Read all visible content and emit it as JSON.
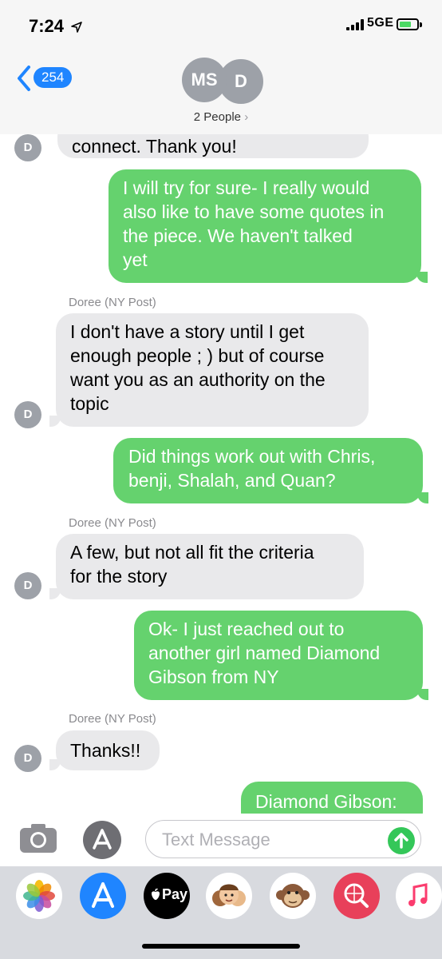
{
  "status": {
    "time": "7:24",
    "network": "5GE"
  },
  "header": {
    "back_count": "254",
    "avatar1": "MS",
    "avatar2": "D",
    "people_label": "2 People"
  },
  "messages": [
    {
      "text": "connect. Thank you!",
      "dir": "in"
    },
    {
      "lines": [
        "I will try for sure- I really would",
        "also like to have some quotes in",
        "the piece. We haven't talked",
        "yet"
      ],
      "dir": "out"
    },
    {
      "sender": "Doree (NY Post)"
    },
    {
      "lines": [
        "I don't have a story until I get",
        "enough people ; ) but of course",
        "want you as an authority on the",
        "topic"
      ],
      "dir": "in"
    },
    {
      "lines": [
        "Did things work out with Chris,",
        "benji, Shalah, and Quan?"
      ],
      "dir": "out"
    },
    {
      "sender": "Doree (NY Post)"
    },
    {
      "lines": [
        "A few, but not all fit the criteria",
        "for the story"
      ],
      "dir": "in"
    },
    {
      "lines": [
        "Ok- I just reached out to",
        "another girl named Diamond",
        "Gibson from NY"
      ],
      "dir": "out"
    },
    {
      "sender": "Doree (NY Post)"
    },
    {
      "text": "Thanks!!",
      "dir": "in"
    },
    {
      "text": "Diamond Gibson:",
      "dir": "out"
    }
  ],
  "avatar_initial": "D",
  "composer": {
    "placeholder": "Text Message"
  },
  "drawer": {
    "apps": [
      "photos-app",
      "app-store-app",
      "apple-pay-app",
      "memoji-app",
      "animoji-app",
      "images-search-app",
      "music-app"
    ],
    "applepay_label": "Pay"
  },
  "colors": {
    "incoming": "#e9e9eb",
    "outgoing": "#65d26e",
    "accent": "#1f85ff"
  }
}
